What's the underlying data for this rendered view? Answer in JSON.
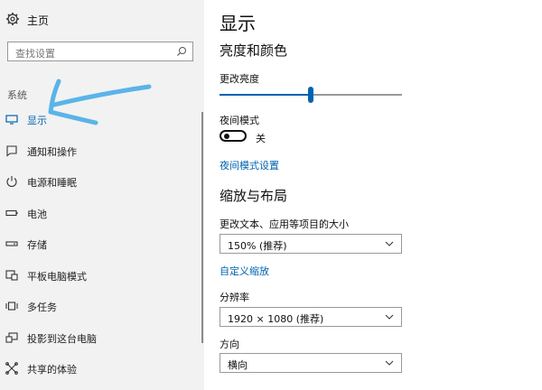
{
  "sidebar": {
    "home_label": "主页",
    "search_placeholder": "查找设置",
    "section_label": "系统",
    "items": [
      {
        "label": "显示",
        "icon": "monitor-icon",
        "active": true
      },
      {
        "label": "通知和操作",
        "icon": "notification-icon"
      },
      {
        "label": "电源和睡眠",
        "icon": "power-icon"
      },
      {
        "label": "电池",
        "icon": "battery-icon"
      },
      {
        "label": "存储",
        "icon": "storage-icon"
      },
      {
        "label": "平板电脑模式",
        "icon": "tablet-mode-icon"
      },
      {
        "label": "多任务",
        "icon": "multitasking-icon"
      },
      {
        "label": "投影到这台电脑",
        "icon": "projecting-icon"
      },
      {
        "label": "共享的体验",
        "icon": "shared-experiences-icon"
      }
    ]
  },
  "main": {
    "page_title": "显示",
    "brightness_section": "亮度和颜色",
    "brightness_label": "更改亮度",
    "brightness_value": 0.5,
    "night_light_label": "夜间模式",
    "night_light_state": "关",
    "night_light_settings_link": "夜间模式设置",
    "scale_section": "缩放与布局",
    "scale_label": "更改文本、应用等项目的大小",
    "scale_value": "150% (推荐)",
    "custom_scaling_link": "自定义缩放",
    "resolution_label": "分辨率",
    "resolution_value": "1920 × 1080 (推荐)",
    "orientation_label": "方向",
    "orientation_value": "横向"
  },
  "colors": {
    "accent": "#0063b1",
    "sidebar_bg": "#f2f2f2",
    "annotation_arrow": "#5ab4e8"
  }
}
